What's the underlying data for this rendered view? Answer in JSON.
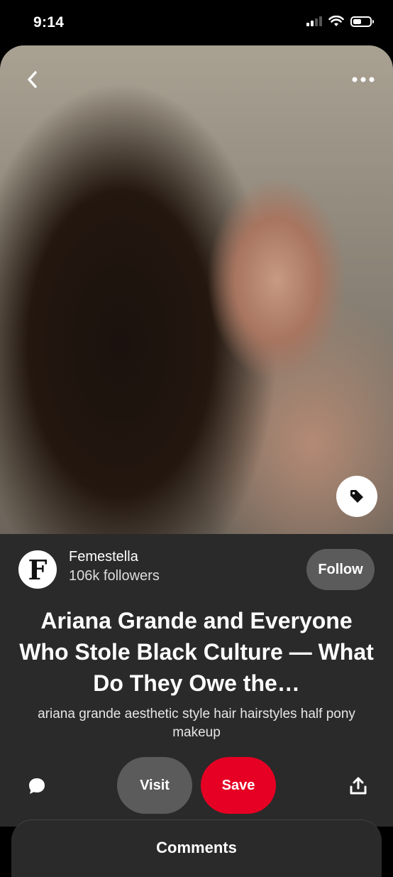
{
  "status_bar": {
    "time": "9:14",
    "battery_level_percent": 50
  },
  "pin": {
    "image": {
      "description_icon": "photo",
      "tag_icon": "tag-icon"
    },
    "creator": {
      "avatar_letter": "F",
      "name": "Femestella",
      "followers": "106k followers",
      "follow_label": "Follow"
    },
    "title": "Ariana Grande and Everyone Who Stole Black Culture — What Do They Owe the…",
    "description": "ariana grande aesthetic style hair hairstyles half pony makeup"
  },
  "actions": {
    "visit_label": "Visit",
    "save_label": "Save",
    "comment_icon": "comment-icon",
    "share_icon": "share-icon"
  },
  "comments": {
    "label": "Comments"
  },
  "colors": {
    "save": "#e60023",
    "secondary_button": "#5b5b5b",
    "card_bg": "#2a2a2a"
  }
}
